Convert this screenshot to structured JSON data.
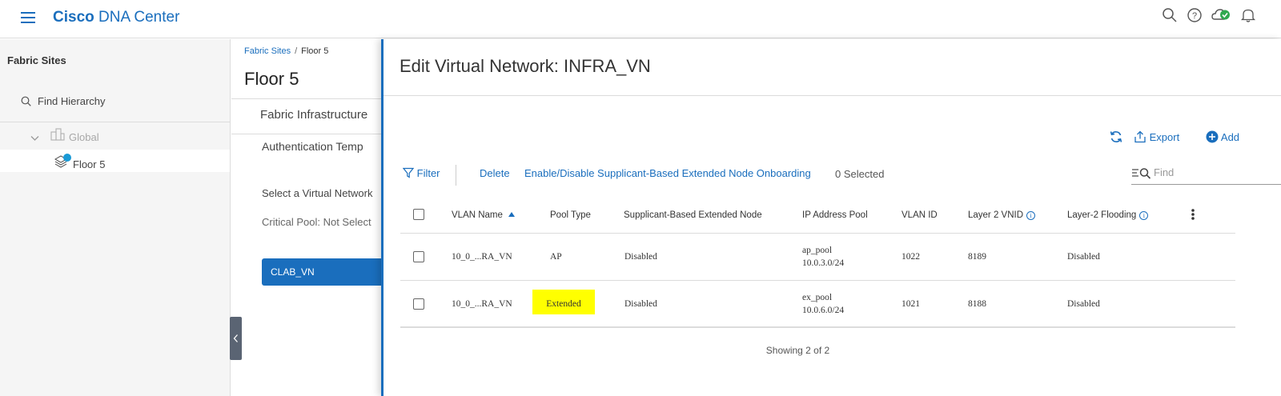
{
  "header": {
    "brand_bold": "Cisco",
    "brand_rest": "DNA Center"
  },
  "sidebar": {
    "title": "Fabric Sites",
    "search_placeholder": "Find Hierarchy",
    "tree": [
      {
        "label": "Global"
      },
      {
        "label": "Floor 5"
      }
    ]
  },
  "mid": {
    "breadcrumb": {
      "link": "Fabric Sites",
      "separator": "/",
      "current": "Floor 5"
    },
    "title": "Floor 5",
    "tab_label": "Fabric Infrastructure",
    "auth_label": "Authentication Temp",
    "select_vn_label": "Select a Virtual Network",
    "critical_pool_label": "Critical Pool: Not Select",
    "vn_button": "CLAB_VN"
  },
  "panel": {
    "title": "Edit Virtual Network: INFRA_VN",
    "toolbar": {
      "export_label": "Export",
      "add_label": "Add"
    },
    "actions": {
      "filter": "Filter",
      "delete": "Delete",
      "enable_disable": "Enable/Disable Supplicant-Based Extended Node Onboarding",
      "selected": "0 Selected",
      "find_placeholder": "Find"
    },
    "columns": [
      "VLAN Name",
      "Pool Type",
      "Supplicant-Based Extended Node",
      "IP Address Pool",
      "VLAN ID",
      "Layer 2 VNID",
      "Layer-2 Flooding"
    ],
    "rows": [
      {
        "vlan_name": "10_0_...RA_VN",
        "pool_type": "AP",
        "supplicant": "Disabled",
        "pool_name": "ap_pool",
        "pool_subnet": "10.0.3.0/24",
        "vlan_id": "1022",
        "vnid": "8189",
        "flooding": "Disabled"
      },
      {
        "vlan_name": "10_0_...RA_VN",
        "pool_type": "Extended",
        "supplicant": "Disabled",
        "pool_name": "ex_pool",
        "pool_subnet": "10.0.6.0/24",
        "vlan_id": "1021",
        "vnid": "8188",
        "flooding": "Disabled"
      }
    ],
    "footer": "Showing 2 of 2"
  },
  "colors": {
    "accent": "#1a6ebd",
    "highlight": "#ffff00",
    "status_ok": "#2fa84f",
    "notification_badge": "#1a9ad6"
  }
}
